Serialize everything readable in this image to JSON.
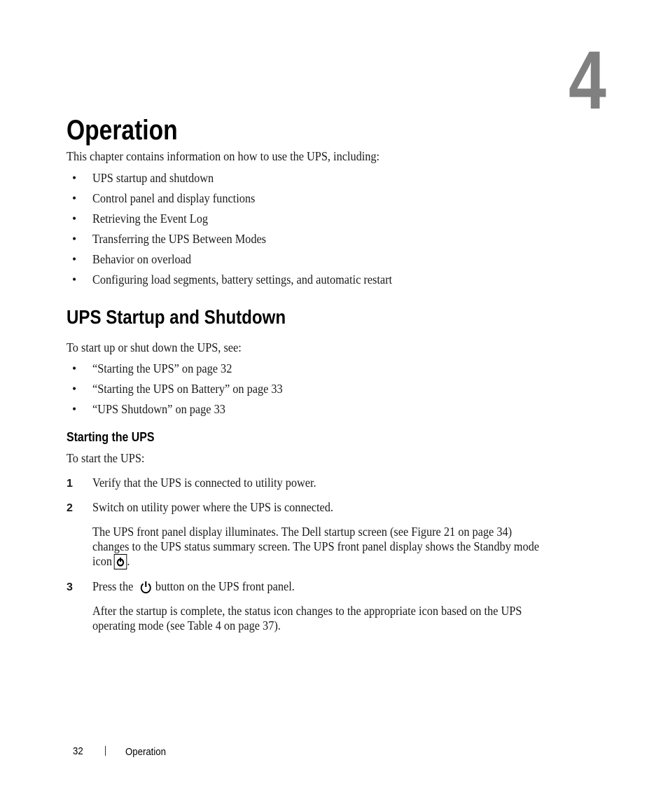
{
  "chapter": {
    "number": "4",
    "title": "Operation",
    "intro": "This chapter contains information on how to use the UPS, including:",
    "topics": [
      "UPS startup and shutdown",
      "Control panel and display functions",
      "Retrieving the Event Log",
      "Transferring the UPS Between Modes",
      "Behavior on overload",
      "Configuring load segments, battery settings, and automatic restart"
    ]
  },
  "section": {
    "title": "UPS Startup and Shutdown",
    "intro": "To start up or shut down the UPS, see:",
    "links": [
      "“Starting the UPS” on page 32",
      "“Starting the UPS on Battery” on page 33",
      "“UPS Shutdown” on page 33"
    ]
  },
  "subsection": {
    "title": "Starting the UPS",
    "intro": "To start the UPS:",
    "steps": [
      {
        "num": "1",
        "text": "Verify that the UPS is connected to utility power."
      },
      {
        "num": "2",
        "text": "Switch on utility power where the UPS is connected."
      },
      {
        "num": "3",
        "text_before": "Press the",
        "text_after": "button on the UPS front panel."
      }
    ],
    "step2_note": {
      "line1": "The UPS front panel display illuminates. The Dell startup screen (see Figure 21 on page 34)",
      "line2": "changes to the UPS status summary screen. The UPS front panel display shows the Standby mode",
      "line3_before": "icon",
      "line3_after": "."
    },
    "step3_note": {
      "line1": "After the startup is complete, the status icon changes to the appropriate icon based on the UPS",
      "line2": "operating mode (see Table 4 on page 37)."
    },
    "icons": [
      "standby-mode-icon",
      "power-button-icon"
    ]
  },
  "footer": {
    "page_number": "32",
    "title": "Operation"
  }
}
